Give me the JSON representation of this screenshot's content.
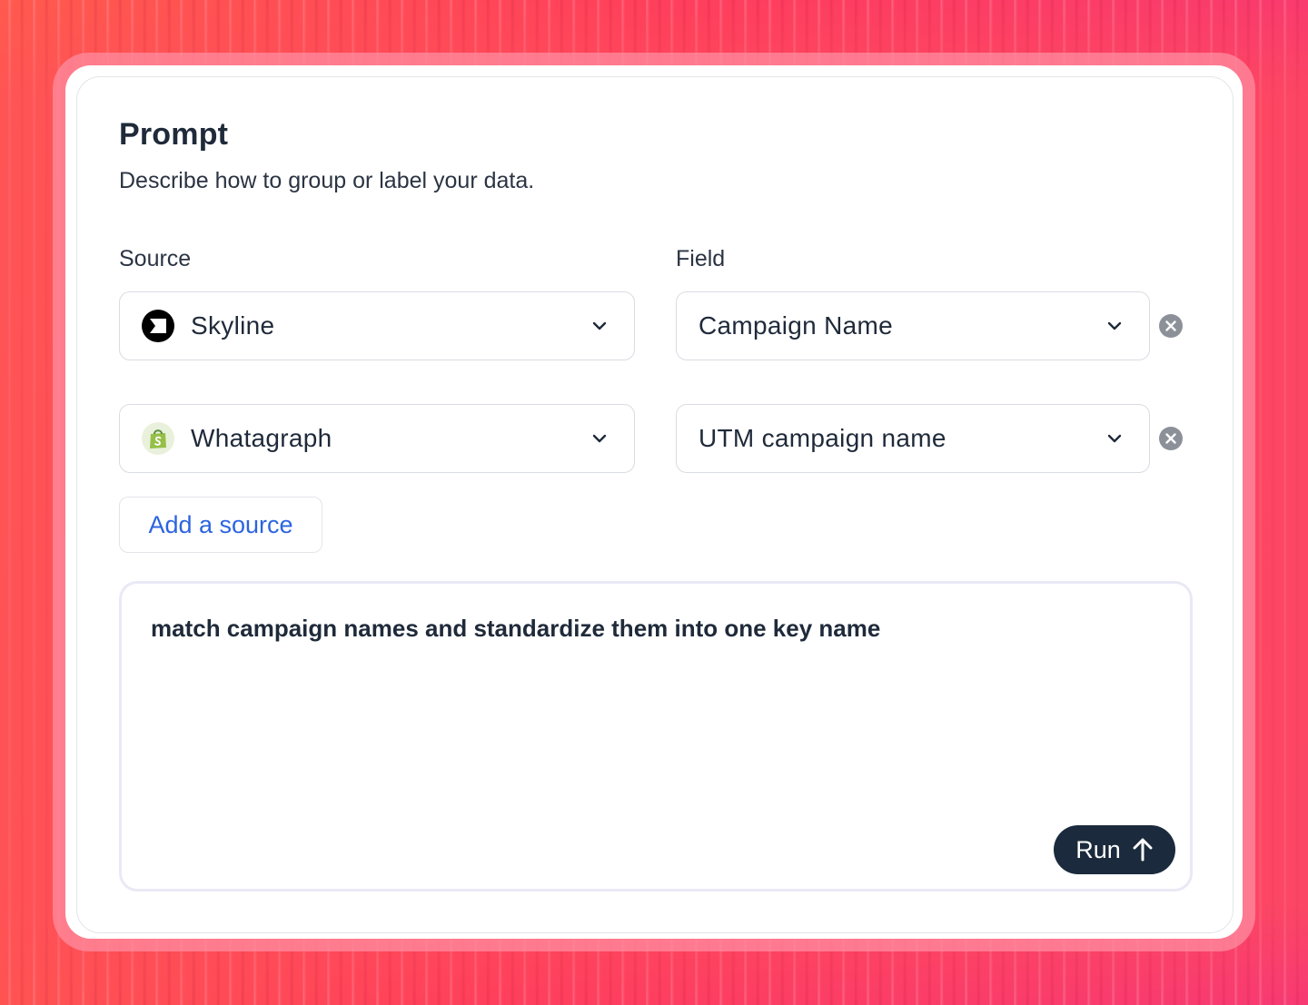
{
  "panel": {
    "title": "Prompt",
    "subtitle": "Describe how to group or label your data."
  },
  "labels": {
    "source": "Source",
    "field": "Field"
  },
  "rows": [
    {
      "source": "Skyline",
      "source_icon": "skyline-logo-icon",
      "field": "Campaign Name"
    },
    {
      "source": "Whatagraph",
      "source_icon": "shopping-bag-logo-icon",
      "field": "UTM campaign name"
    }
  ],
  "add_source_label": "Add a source",
  "prompt": {
    "value": "match campaign names and standardize them into one key name"
  },
  "run_label": "Run",
  "colors": {
    "accent_link": "#2c64e0",
    "run_button": "#1b2a3c",
    "text_primary": "#1f2a3a",
    "shopify_green": "#95bf47"
  }
}
